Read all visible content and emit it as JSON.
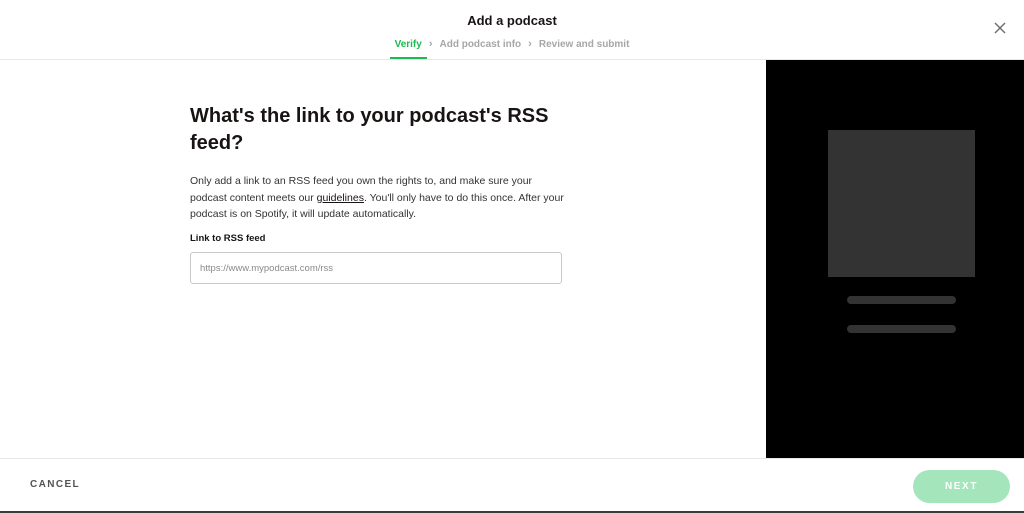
{
  "header": {
    "title": "Add a podcast",
    "steps": [
      {
        "label": "Verify",
        "state": "active"
      },
      {
        "label": "Add podcast info",
        "state": "inactive"
      },
      {
        "label": "Review and submit",
        "state": "inactive"
      }
    ],
    "close_icon": "close-icon"
  },
  "main": {
    "heading": "What's the link to your podcast's RSS feed?",
    "description_before_link": "Only add a link to an RSS feed you own the rights to, and make sure your podcast content meets our ",
    "description_link": "guidelines",
    "description_after_link": ". You'll only have to do this once. After your podcast is on Spotify, it will update automatically.",
    "field_label": "Link to RSS feed",
    "field_value": "",
    "field_placeholder": "https://www.mypodcast.com/rss"
  },
  "footer": {
    "cancel_label": "CANCEL",
    "next_label": "NEXT"
  },
  "colors": {
    "accent": "#1db954",
    "next_disabled": "#a4e5bb",
    "preview_background": "#000000",
    "preview_placeholder": "#333333"
  }
}
